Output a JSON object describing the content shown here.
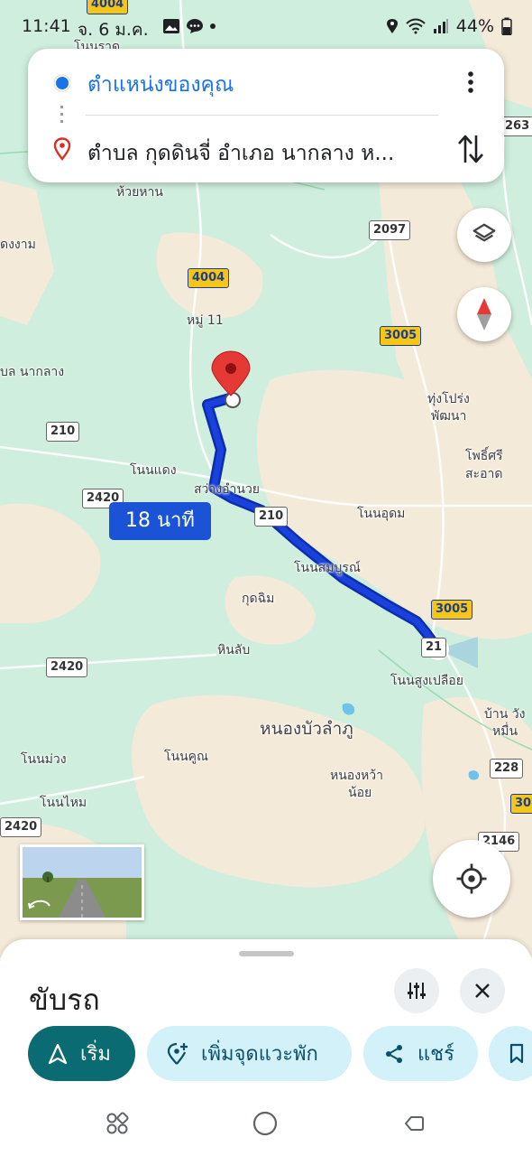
{
  "status_bar": {
    "time": "11:41",
    "date": "จ. 6 ม.ค.",
    "battery": "44%"
  },
  "route": {
    "origin": "ตำแหน่งของคุณ",
    "destination": "ตำบล กุดดินจี่ อำเภอ นากลาง ห..."
  },
  "map": {
    "eta_label": "18 นาที",
    "places": {
      "huai_han": "ห้วยหาน",
      "dong_ngam": "ดงงาม",
      "mu_11": "หมู่ 11",
      "bon_naklang": "บล นากลาง",
      "non_daeng": "โนนแดง",
      "sawang_amnuai": "สว่างอำนวย",
      "thung_prong_1": "ทุ่งโปร่ง",
      "thung_prong_2": "พัฒนา",
      "pho_si_1": "โพธิ์ศรี",
      "pho_si_2": "สะอาด",
      "non_udom": "โนนอุดม",
      "non_sombun": "โนนสมบูรณ์",
      "kut_chim": "กุดฉิม",
      "hin_lap": "หินลับ",
      "non_sung": "โนนสูงเปลือย",
      "ban_wang_1": "บ้าน วัง",
      "ban_wang_2": "หมื่น",
      "nong_bua_lamphu": "หนองบัวลำภู",
      "non_muang": "โนนม่วง",
      "non_khun": "โนนคูณ",
      "nong_wa_1": "หนองหว้า",
      "nong_wa_2": "น้อย",
      "non_mai": "โนนไหม",
      "no_rat": "โนนราด"
    },
    "shields": {
      "s4004_top": "4004",
      "s4004": "4004",
      "s2097": "2097",
      "s3005": "3005",
      "s3005_b": "3005",
      "s210_a": "210",
      "s210_b": "210",
      "s2420_a": "2420",
      "s2420_b": "2420",
      "s2420_c": "2420",
      "s228": "228",
      "s2146": "2146",
      "s263": "263",
      "s30": "30",
      "s21": "21"
    }
  },
  "sheet": {
    "mode_title": "ขับรถ",
    "start_label": "เริ่ม",
    "add_stop_label": "เพิ่มจุดแวะพัก",
    "share_label": "แชร์"
  },
  "icons": {
    "layers": "layers-icon",
    "compass": "compass-icon",
    "locate": "my-location-icon",
    "more": "more-vert-icon",
    "swap": "swap-vertical-icon",
    "tune": "tune-icon",
    "close": "close-icon",
    "navigate": "navigation-arrow-icon",
    "add_stop": "add-location-icon",
    "share": "share-icon",
    "save": "bookmark-icon"
  },
  "colors": {
    "route": "#1a40e0",
    "start_chip": "#0b6b73",
    "chip_light": "#d3f1f8",
    "map_green": "#cfeedd",
    "map_tan": "#f4ead9",
    "pin_red": "#e53935",
    "user_blue": "#1a73e8"
  }
}
